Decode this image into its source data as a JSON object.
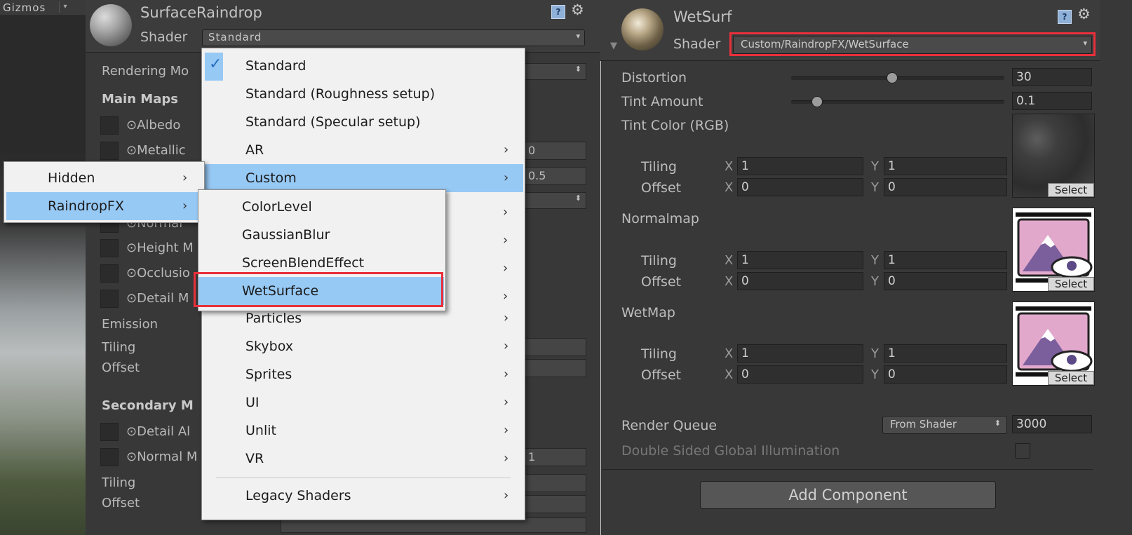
{
  "left": {
    "scene": {
      "gizmos_label": "Gizmos"
    },
    "header": {
      "material_name": "SurfaceRaindrop",
      "shader_label": "Shader",
      "shader_value": "Standard"
    },
    "inspector": {
      "rendering_mode": "Rendering Mo",
      "main_maps": "Main Maps",
      "albedo": "⊙Albedo",
      "metallic": "⊙Metallic",
      "metallic_value": "0",
      "smoothness_value": "0.5",
      "normal_map": "⊙Normal",
      "height_map": "⊙Height M",
      "occlusion": "⊙Occlusio",
      "detail_mask": "⊙Detail M",
      "emission": "Emission",
      "tiling": "Tiling",
      "offset": "Offset",
      "secondary_maps": "Secondary M",
      "detail_albedo": "⊙Detail Al",
      "secondary_normal": "⊙Normal M",
      "secondary_normal_value": "1",
      "tiling2": "Tiling",
      "offset2": "Offset"
    },
    "shader_menu": {
      "items": [
        {
          "label": "Standard"
        },
        {
          "label": "Standard (Roughness setup)"
        },
        {
          "label": "Standard (Specular setup)"
        },
        {
          "label": "AR"
        },
        {
          "label": "Custom"
        },
        {
          "label": "Particles"
        },
        {
          "label": "Skybox"
        },
        {
          "label": "Sprites"
        },
        {
          "label": "UI"
        },
        {
          "label": "Unlit"
        },
        {
          "label": "VR"
        },
        {
          "label": "Legacy Shaders"
        }
      ]
    },
    "custom_submenu": {
      "items": [
        {
          "label": "Hidden"
        },
        {
          "label": "RaindropFX"
        }
      ]
    },
    "raindrop_submenu": {
      "items": [
        {
          "label": "ColorLevel"
        },
        {
          "label": "GaussianBlur"
        },
        {
          "label": "ScreenBlendEffect"
        },
        {
          "label": "WetSurface"
        }
      ]
    }
  },
  "right": {
    "header": {
      "material_name": "WetSurf",
      "shader_label": "Shader",
      "shader_value": "Custom/RaindropFX/WetSurface"
    },
    "properties": {
      "distortion_label": "Distortion",
      "distortion_value": "30",
      "distortion_level": 0.47,
      "tint_amount_label": "Tint Amount",
      "tint_amount_value": "0.1",
      "tint_amount_level": 0.12,
      "tint_color_label": "Tint Color (RGB)",
      "normalmap_label": "Normalmap",
      "wetmap_label": "WetMap"
    },
    "tex_blocks": [
      {
        "tiling_label": "Tiling",
        "offset_label": "Offset",
        "x_label": "X",
        "y_label": "Y",
        "tiling_x": "1",
        "tiling_y": "1",
        "offset_x": "0",
        "offset_y": "0",
        "select_label": "Select"
      },
      {
        "tiling_label": "Tiling",
        "offset_label": "Offset",
        "x_label": "X",
        "y_label": "Y",
        "tiling_x": "1",
        "tiling_y": "1",
        "offset_x": "0",
        "offset_y": "0",
        "select_label": "Select"
      },
      {
        "tiling_label": "Tiling",
        "offset_label": "Offset",
        "x_label": "X",
        "y_label": "Y",
        "tiling_x": "1",
        "tiling_y": "1",
        "offset_x": "0",
        "offset_y": "0",
        "select_label": "Select"
      }
    ],
    "render_queue": {
      "label": "Render Queue",
      "mode": "From Shader",
      "value": "3000"
    },
    "double_sided": {
      "label": "Double Sided Global Illumination"
    },
    "add_component": "Add Component"
  },
  "colors": {
    "highlight": "#97c9f5",
    "callout_border": "#e8303b",
    "panel_bg": "#383838"
  },
  "icons": [
    "help-icon",
    "gear-icon",
    "checkmark-icon",
    "chevron-right-icon",
    "dropdown-arrow-icon"
  ]
}
